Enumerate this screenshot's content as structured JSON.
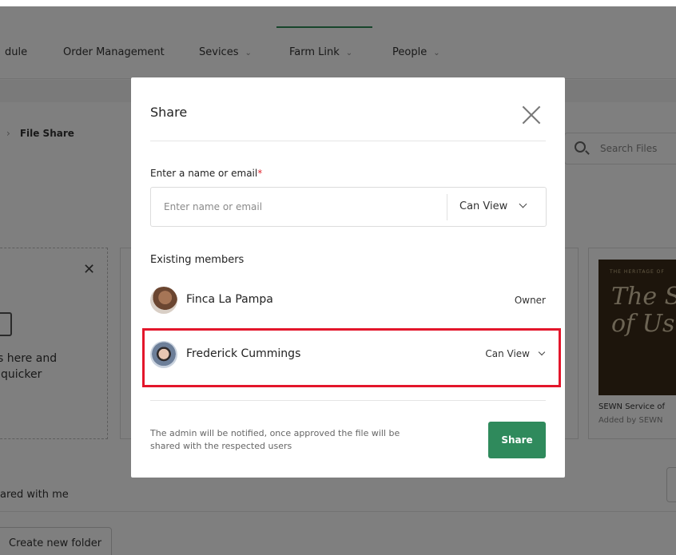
{
  "background": {
    "nav": {
      "items": [
        {
          "label": "dule",
          "has_chevron": false
        },
        {
          "label": "Order Management",
          "has_chevron": false
        },
        {
          "label": "Sevices",
          "has_chevron": true
        },
        {
          "label": "Farm Link",
          "has_chevron": true,
          "active": true
        },
        {
          "label": "People",
          "has_chevron": true
        }
      ]
    },
    "breadcrumb": {
      "current": "File Share"
    },
    "search": {
      "placeholder": "Search Files"
    },
    "upload": {
      "line1": "s here and",
      "line2": "quicker"
    },
    "card": {
      "thumb_small": "THE HERITAGE OF",
      "thumb_big_1": "The S",
      "thumb_big_2": "of Us",
      "title": "SEWN Service of",
      "subtitle": "Added by SEWN"
    },
    "shared_heading": "ared with me",
    "create_folder_label": "Create new folder"
  },
  "modal": {
    "title": "Share",
    "field_label": "Enter a name or email",
    "required_mark": "*",
    "input": {
      "value": "",
      "placeholder": "Enter name or email"
    },
    "permission": {
      "selected": "Can View",
      "options": [
        "Can View"
      ]
    },
    "existing_members_title": "Existing members",
    "members": [
      {
        "name": "Finca La Pampa",
        "role": "Owner",
        "editable": false
      },
      {
        "name": "Frederick Cummings",
        "role": "Can View",
        "editable": true
      }
    ],
    "note": "The admin will be notified, once approved the file will be shared with the respected users",
    "share_label": "Share"
  },
  "colors": {
    "primary_green": "#2f8a5c",
    "required_red": "#e0262f",
    "highlight_red": "#e3162b"
  }
}
